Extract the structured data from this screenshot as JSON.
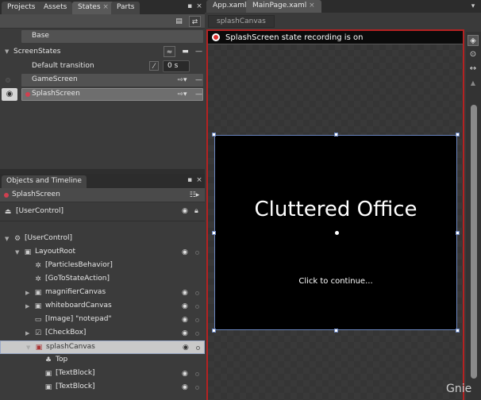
{
  "left_panel": {
    "tabs": [
      {
        "label": "Projects",
        "active": false
      },
      {
        "label": "Assets",
        "active": false
      },
      {
        "label": "States",
        "active": true,
        "closable": true
      },
      {
        "label": "Parts",
        "active": false
      }
    ],
    "tab_icons": {
      "pin": "pin-icon",
      "close": "close-icon",
      "close_glyph": "×",
      "pin_glyph": "▪"
    },
    "toolbar": {
      "add_state_group": "add-state-group-icon",
      "add_state": "add-state-icon"
    },
    "states": {
      "base": {
        "label": "Base"
      },
      "group": {
        "label": "ScreenStates",
        "default_transition_label": "Default transition",
        "default_transition_value": "0 s",
        "items": [
          {
            "label": "GameScreen",
            "selected": false,
            "recording": false
          },
          {
            "label": "SplashScreen",
            "selected": true,
            "recording": true
          }
        ]
      }
    }
  },
  "objects_panel": {
    "tab_label": "Objects and Timeline",
    "current_state": "SplashScreen",
    "scope": "[UserControl]",
    "tree": [
      {
        "label": "[UserControl]",
        "depth": 0,
        "expander": "▼",
        "icon": "user-control-icon",
        "eye": false
      },
      {
        "label": "LayoutRoot",
        "depth": 1,
        "expander": "▼",
        "icon": "grid-icon",
        "eye": true
      },
      {
        "label": "[ParticlesBehavior]",
        "depth": 2,
        "expander": "",
        "icon": "behavior-icon",
        "eye": false
      },
      {
        "label": "[GoToStateAction]",
        "depth": 2,
        "expander": "",
        "icon": "action-icon",
        "eye": false
      },
      {
        "label": "magnifierCanvas",
        "depth": 2,
        "expander": "▶",
        "icon": "canvas-icon",
        "eye": true
      },
      {
        "label": "whiteboardCanvas",
        "depth": 2,
        "expander": "▶",
        "icon": "canvas-icon",
        "eye": true
      },
      {
        "label": "[Image] \"notepad\"",
        "depth": 2,
        "expander": "",
        "icon": "image-icon",
        "eye": true
      },
      {
        "label": "[CheckBox]",
        "depth": 2,
        "expander": "▶",
        "icon": "checkbox-icon",
        "eye": true
      },
      {
        "label": "splashCanvas",
        "depth": 2,
        "expander": "▼",
        "icon": "canvas-recording-icon",
        "eye": true,
        "selected": true
      },
      {
        "label": "Top",
        "depth": 3,
        "expander": "",
        "icon": "trigger-icon",
        "eye": false
      },
      {
        "label": "[TextBlock]",
        "depth": 3,
        "expander": "",
        "icon": "textblock-icon",
        "eye": true
      },
      {
        "label": "[TextBlock]",
        "depth": 3,
        "expander": "",
        "icon": "textblock-icon",
        "eye": true
      }
    ]
  },
  "document": {
    "tabs": [
      {
        "label": "App.xaml",
        "active": false
      },
      {
        "label": "MainPage.xaml",
        "active": true,
        "closable": true
      }
    ],
    "breadcrumb": "splashCanvas",
    "recording_message": "SplashScreen state recording is on",
    "canvas": {
      "title": "Cluttered Office",
      "subtitle": "Click to continue..."
    }
  },
  "colors": {
    "recording_border": "#b52222",
    "selection": "#6b86c0"
  },
  "watermark": "Gnie"
}
